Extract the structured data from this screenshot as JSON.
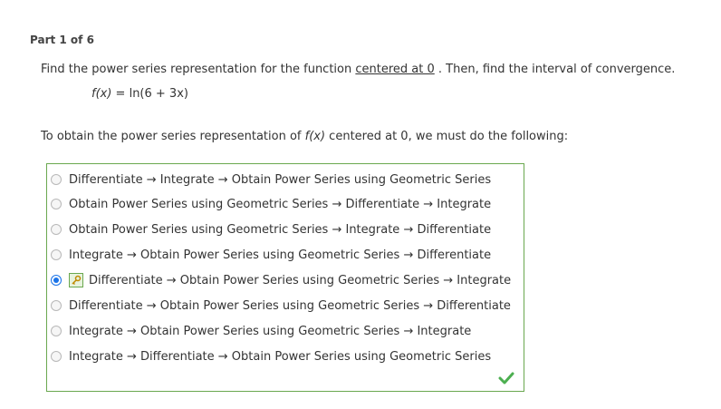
{
  "part_label": "Part 1 of 6",
  "question": {
    "prefix": "Find the power series representation for the function ",
    "link_text": "centered at 0",
    "suffix": " . Then, find the interval of convergence."
  },
  "function": {
    "name": "f(x)",
    "rest": " = ln(6 + 3x)"
  },
  "instruction": {
    "prefix": "To obtain the power series representation of ",
    "func": "f(x)",
    "suffix": " centered at 0, we must do the following:"
  },
  "options": [
    {
      "label": "Differentiate → Integrate → Obtain Power Series using Geometric Series",
      "selected": false
    },
    {
      "label": "Obtain Power Series using Geometric Series → Differentiate → Integrate",
      "selected": false
    },
    {
      "label": "Obtain Power Series using Geometric Series → Integrate → Differentiate",
      "selected": false
    },
    {
      "label": "Integrate → Obtain Power Series using Geometric Series → Differentiate",
      "selected": false
    },
    {
      "label": "Differentiate → Obtain Power Series using Geometric Series → Integrate",
      "selected": true
    },
    {
      "label": "Differentiate → Obtain Power Series using Geometric Series → Differentiate",
      "selected": false
    },
    {
      "label": "Integrate → Obtain Power Series using Geometric Series → Integrate",
      "selected": false
    },
    {
      "label": "Integrate → Differentiate → Obtain Power Series using Geometric Series",
      "selected": false
    }
  ],
  "icons": {
    "key": "key-icon",
    "correct": "checkmark-icon"
  },
  "colors": {
    "correct_green": "#6aa84f",
    "radio_selected": "#1a73e8",
    "key_badge_bg": "#e7f3dd"
  }
}
